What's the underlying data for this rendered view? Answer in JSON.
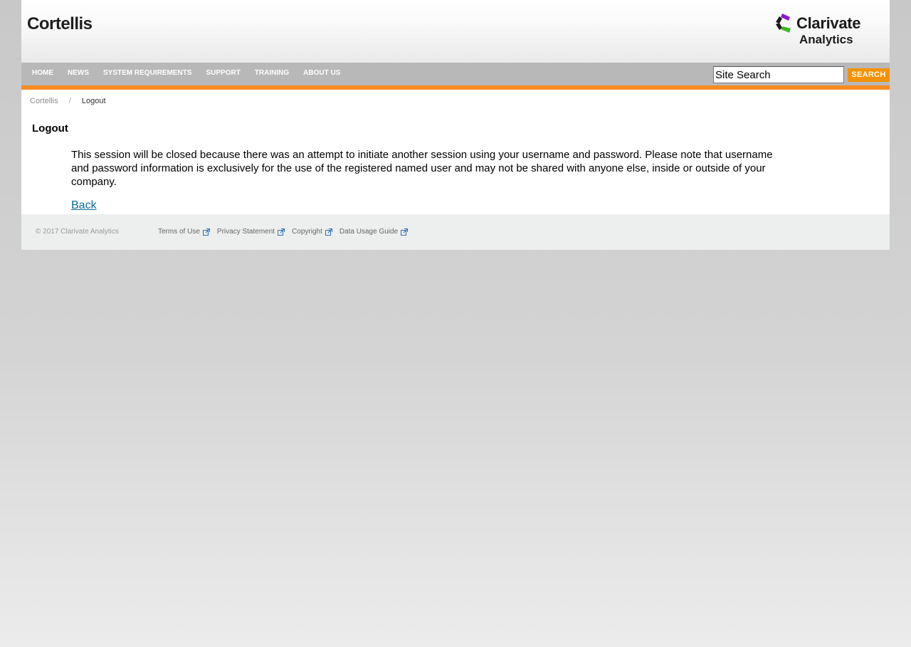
{
  "header": {
    "brand": "Cortellis",
    "logo": {
      "line1": "Clarivate",
      "line2": "Analytics",
      "colors": {
        "purple": "#8a17c9",
        "green": "#3db81f",
        "dark": "#1b1b1b"
      }
    }
  },
  "nav": {
    "items": [
      {
        "label": "HOME"
      },
      {
        "label": "NEWS"
      },
      {
        "label": "SYSTEM REQUIREMENTS"
      },
      {
        "label": "SUPPORT"
      },
      {
        "label": "TRAINING"
      },
      {
        "label": "ABOUT US"
      }
    ],
    "search": {
      "value": "Site Search",
      "button_label": "SEARCH"
    }
  },
  "breadcrumb": {
    "root": "Cortellis",
    "separator": "/",
    "current": "Logout"
  },
  "main": {
    "title": "Logout",
    "message": "This session will be closed because there was an attempt to initiate another session using your username and password. Please note that username and password information is exclusively for the use of the registered named user and may not be shared with anyone else, inside or outside of your company.",
    "back_label": "Back"
  },
  "footer": {
    "copyright": "© 2017 Clarivate Analytics",
    "links": [
      {
        "label": "Terms of Use"
      },
      {
        "label": "Privacy Statement"
      },
      {
        "label": "Copyright"
      },
      {
        "label": "Data Usage Guide"
      }
    ]
  },
  "colors": {
    "accent": "#f68b1f",
    "nav_bg": "#b8b8b8",
    "link": "#0a6b9c",
    "footer_bg": "#ecefee"
  }
}
